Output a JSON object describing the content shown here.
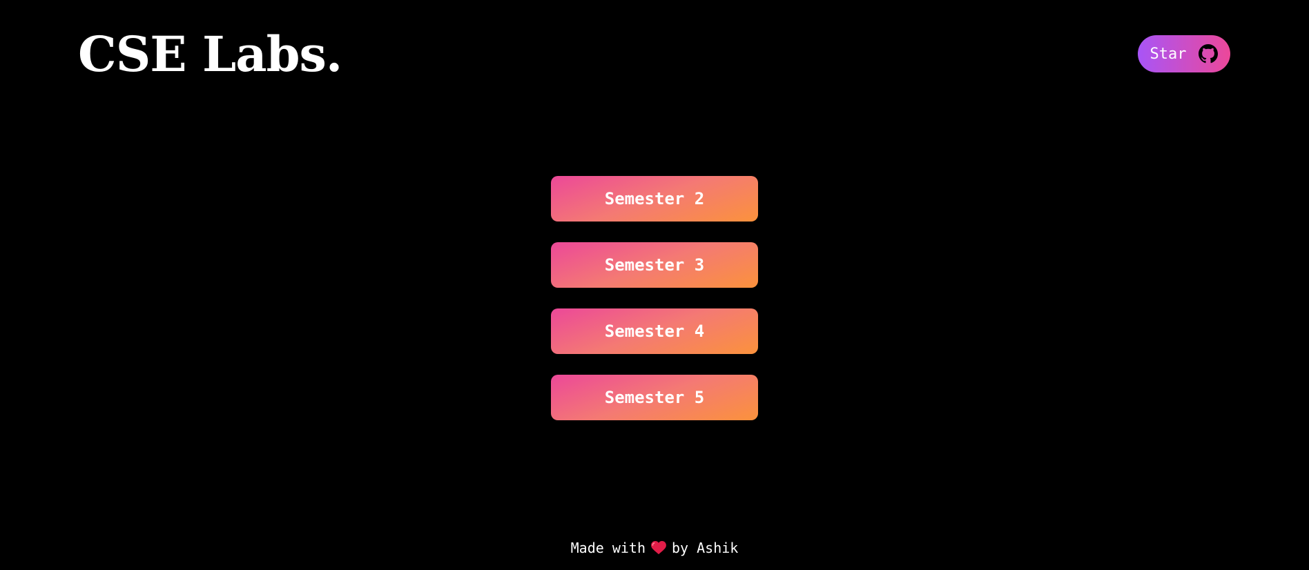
{
  "header": {
    "brand": "CSE Labs.",
    "star_label": "Star",
    "star_icon": "github-icon"
  },
  "semesters": [
    {
      "label": "Semester 2"
    },
    {
      "label": "Semester 3"
    },
    {
      "label": "Semester 4"
    },
    {
      "label": "Semester 5"
    }
  ],
  "footer": {
    "prefix": "Made with",
    "icon": "heart-icon",
    "suffix": "by Ashik"
  },
  "colors": {
    "background": "#000000",
    "text": "#ffffff",
    "star_gradient": [
      "#a855f7",
      "#ec4899"
    ],
    "semester_gradient": [
      "#ec4899",
      "#fb923c"
    ],
    "heart": "#e11d48"
  }
}
